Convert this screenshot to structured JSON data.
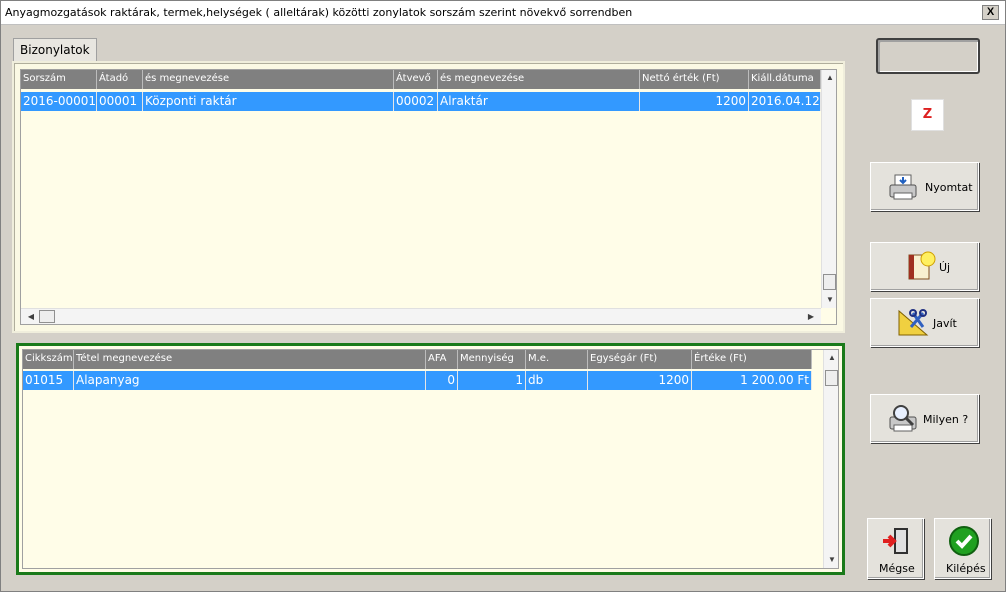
{
  "window": {
    "title": "Anyagmozgatások raktárak, termek,helységek ( alleltárak) közötti zonylatok sorszám szerint növekvő sorrendben",
    "close_label": "X"
  },
  "tabs": [
    {
      "label": "Bizonylatok"
    }
  ],
  "documents_grid": {
    "columns": [
      "Sorszám",
      "Átadó",
      "és megnevezése",
      "Átvevő",
      "és megnevezése",
      "Nettó érték (Ft)",
      "Kiáll.dátuma"
    ],
    "rows": [
      [
        "2016-00001",
        "00001",
        "Központi raktár",
        "00002",
        "Alraktár",
        "1200",
        "2016.04.12"
      ]
    ]
  },
  "items_grid": {
    "columns": [
      "Cikkszám",
      "Tétel megnevezése",
      "AFA",
      "Mennyiség",
      "M.e.",
      "Egységár (Ft)",
      "Értéke (Ft)"
    ],
    "rows": [
      [
        "01015",
        "Alapanyag",
        "0",
        "1",
        "db",
        "1200",
        "1 200.00 Ft"
      ]
    ]
  },
  "buttons": {
    "z": "Z",
    "print": "Nyomtat",
    "new": "Új",
    "edit": "Javít",
    "which": "Milyen ?",
    "cancel": "Mégse",
    "exit": "Kilépés"
  },
  "icons": {
    "print": "printer-icon",
    "new": "new-document-icon",
    "edit": "edit-tools-icon",
    "which": "magnify-printer-icon",
    "cancel": "exit-door-icon",
    "exit": "check-ok-icon"
  },
  "colors": {
    "selection": "#3399ff",
    "grid_background": "#fffde8",
    "header": "#808080",
    "panel_border": "#1a7a1a",
    "z_text": "#dd2020"
  }
}
